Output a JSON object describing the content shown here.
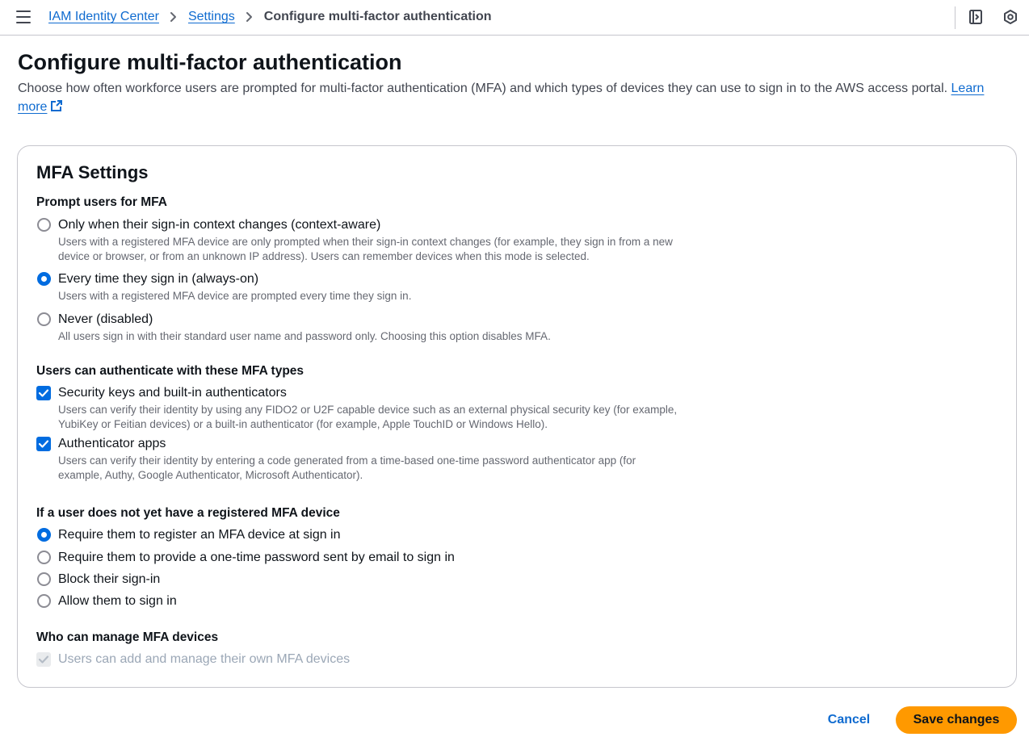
{
  "header": {
    "breadcrumbs": [
      {
        "label": "IAM Identity Center"
      },
      {
        "label": "Settings"
      },
      {
        "label": "Configure multi-factor authentication"
      }
    ]
  },
  "page": {
    "title": "Configure multi-factor authentication",
    "description": "Choose how often workforce users are prompted for multi-factor authentication (MFA) and which types of devices they can use to sign in to the AWS access portal. ",
    "learn_more": "Learn more"
  },
  "panel": {
    "title": "MFA Settings",
    "prompt": {
      "label": "Prompt users for MFA",
      "selected": "Every time they sign in (always-on)",
      "options": [
        {
          "label": "Only when their sign-in context changes (context-aware)",
          "description": "Users with a registered MFA device are only prompted when their sign-in context changes (for example, they sign in from a new device or browser, or from an unknown IP address). Users can remember devices when this mode is selected."
        },
        {
          "label": "Every time they sign in (always-on)",
          "description": "Users with a registered MFA device are prompted every time they sign in."
        },
        {
          "label": "Never (disabled)",
          "description": "All users sign in with their standard user name and password only. Choosing this option disables MFA."
        }
      ]
    },
    "types": {
      "label": "Users can authenticate with these MFA types",
      "options": [
        {
          "label": "Security keys and built-in authenticators",
          "checked": true,
          "description": "Users can verify their identity by using any FIDO2 or U2F capable device such as an external physical security key (for example, YubiKey or Feitian devices) or a built-in authenticator (for example, Apple TouchID or Windows Hello)."
        },
        {
          "label": "Authenticator apps",
          "checked": true,
          "description": "Users can verify their identity by entering a code generated from a time-based one-time password authenticator app (for example, Authy, Google Authenticator, Microsoft Authenticator)."
        }
      ]
    },
    "no_device": {
      "label": "If a user does not yet have a registered MFA device",
      "selected": "Require them to register an MFA device at sign in",
      "options": [
        {
          "label": "Require them to register an MFA device at sign in"
        },
        {
          "label": "Require them to provide a one-time password sent by email to sign in"
        },
        {
          "label": "Block their sign-in"
        },
        {
          "label": "Allow them to sign in"
        }
      ]
    },
    "manage": {
      "label": "Who can manage MFA devices",
      "option": {
        "label": "Users can add and manage their own MFA devices",
        "checked": true,
        "disabled": true
      }
    }
  },
  "footer": {
    "cancel_label": "Cancel",
    "save_label": "Save changes"
  },
  "colors": {
    "accent": "#006ce0",
    "link": "#0f6bd0",
    "primary_button": "#ff9900"
  },
  "icons": [
    "menu-icon",
    "chevron-right-icon",
    "panel-toggle-icon",
    "settings-hex-icon",
    "external-link-icon",
    "check-icon"
  ]
}
